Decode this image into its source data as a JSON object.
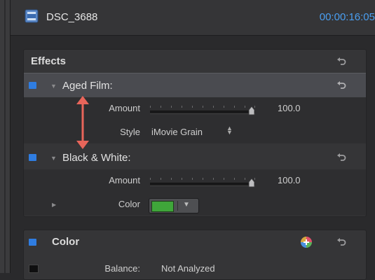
{
  "header": {
    "clip_name": "DSC_3688",
    "timecode": "00:00:16:05",
    "clip_icon": "film-clip-icon"
  },
  "effects": {
    "title": "Effects",
    "items": [
      {
        "name": "Aged Film:",
        "enabled": true,
        "selected": true,
        "params": [
          {
            "label": "Amount",
            "value": "100.0",
            "level": 1.0
          },
          {
            "label": "Style",
            "value": "iMovie Grain"
          }
        ]
      },
      {
        "name": "Black & White:",
        "enabled": true,
        "selected": false,
        "params": [
          {
            "label": "Amount",
            "value": "100.0",
            "level": 1.0
          },
          {
            "label": "Color",
            "swatch": "#3fa63a"
          }
        ]
      }
    ]
  },
  "color": {
    "title": "Color",
    "balance_label": "Balance:",
    "balance_value": "Not Analyzed"
  },
  "colors": {
    "accent_blue": "#2f7de1",
    "timecode_blue": "#4a9ef0",
    "annotation_red": "#e8655a",
    "panel_bg": "#353537"
  },
  "icons": {
    "reset": "reset-arrow-icon",
    "add": "add-color-icon",
    "popup": "popup-arrows-icon"
  }
}
